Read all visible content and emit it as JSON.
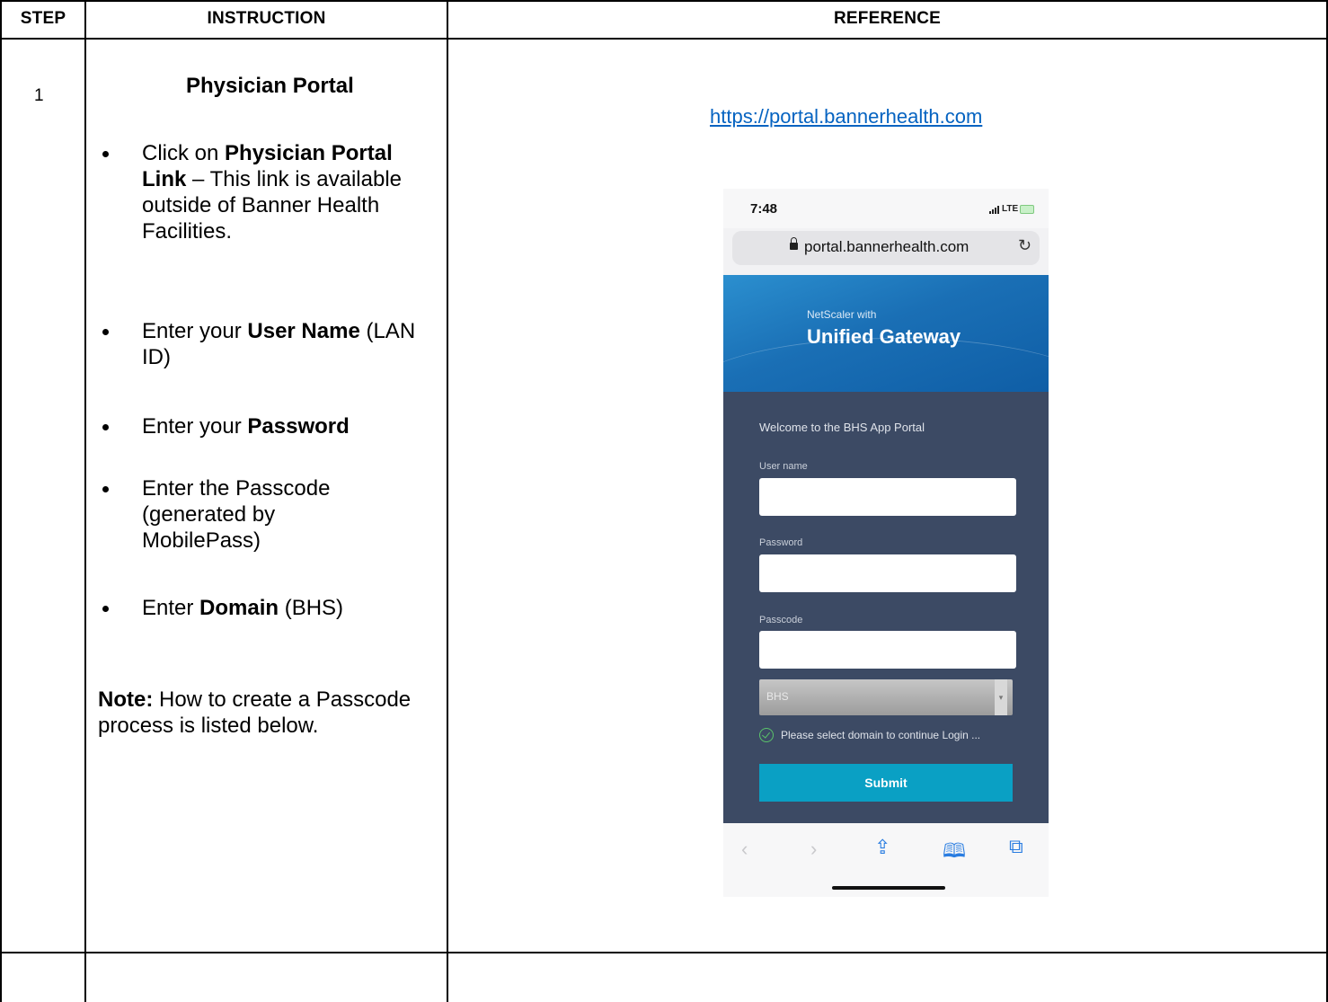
{
  "table": {
    "headers": {
      "step": "STEP",
      "instruction": "INSTRUCTION",
      "reference": "REFERENCE"
    },
    "rows": [
      {
        "step": "1",
        "title": "Physician Portal",
        "bullets": [
          {
            "pre": "Click on ",
            "bold": "Physician Portal Link",
            "post": " – This link is available outside of Banner Health Facilities."
          },
          {
            "pre": "Enter your ",
            "bold": "User Name",
            "post": " (LAN ID)"
          },
          {
            "pre": "Enter your ",
            "bold": "Password",
            "post": ""
          },
          {
            "pre": "Enter the Passcode (generated by MobilePass)",
            "bold": "",
            "post": ""
          },
          {
            "pre": "Enter ",
            "bold": "Domain",
            "post": " (BHS)"
          }
        ],
        "note_label": "Note:",
        "note_text": " How to create a Passcode process is listed below.",
        "reference_link": "https://portal.bannerhealth.com"
      }
    ]
  },
  "phone": {
    "time": "7:48",
    "network": "LTE",
    "address": "portal.bannerhealth.com",
    "reload_icon": "reload-icon",
    "brand_small": "NetScaler with",
    "brand_big": "Unified Gateway",
    "welcome": "Welcome to the BHS App Portal",
    "fields": {
      "user_label": "User name",
      "password_label": "Password",
      "passcode_label": "Passcode"
    },
    "domain_value": "BHS",
    "hint": "Please select domain to continue Login ...",
    "submit": "Submit",
    "toolbar_icons": [
      "back-icon",
      "forward-icon",
      "share-icon",
      "bookmarks-icon",
      "tabs-icon"
    ],
    "colors": {
      "hero": "#1a6fb5",
      "form_bg": "#3c4a64",
      "submit": "#0aa0c4",
      "link": "#0563c1"
    }
  }
}
